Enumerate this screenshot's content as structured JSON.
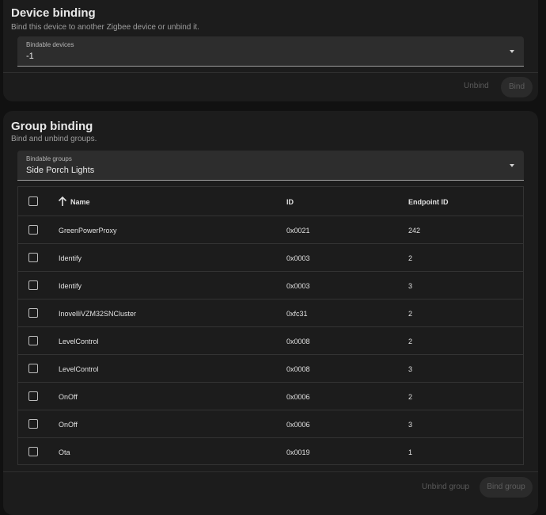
{
  "device_binding": {
    "title": "Device binding",
    "description": "Bind this device to another Zigbee device or unbind it.",
    "select_label": "Bindable devices",
    "select_value": "-1",
    "unbind_label": "Unbind",
    "bind_label": "Bind"
  },
  "group_binding": {
    "title": "Group binding",
    "description": "Bind and unbind groups.",
    "select_label": "Bindable groups",
    "select_value": "Side Porch Lights",
    "unbind_label": "Unbind group",
    "bind_label": "Bind group",
    "table": {
      "columns": {
        "name": "Name",
        "id": "ID",
        "endpoint": "Endpoint ID"
      },
      "rows": [
        {
          "name": "GreenPowerProxy",
          "id": "0x0021",
          "endpoint": "242"
        },
        {
          "name": "Identify",
          "id": "0x0003",
          "endpoint": "2"
        },
        {
          "name": "Identify",
          "id": "0x0003",
          "endpoint": "3"
        },
        {
          "name": "InovelliVZM32SNCluster",
          "id": "0xfc31",
          "endpoint": "2"
        },
        {
          "name": "LevelControl",
          "id": "0x0008",
          "endpoint": "2"
        },
        {
          "name": "LevelControl",
          "id": "0x0008",
          "endpoint": "3"
        },
        {
          "name": "OnOff",
          "id": "0x0006",
          "endpoint": "2"
        },
        {
          "name": "OnOff",
          "id": "0x0006",
          "endpoint": "3"
        },
        {
          "name": "Ota",
          "id": "0x0019",
          "endpoint": "1"
        }
      ]
    }
  },
  "icons": {
    "sort": "arrow-up-icon",
    "dropdown": "dropdown-arrow-icon"
  }
}
